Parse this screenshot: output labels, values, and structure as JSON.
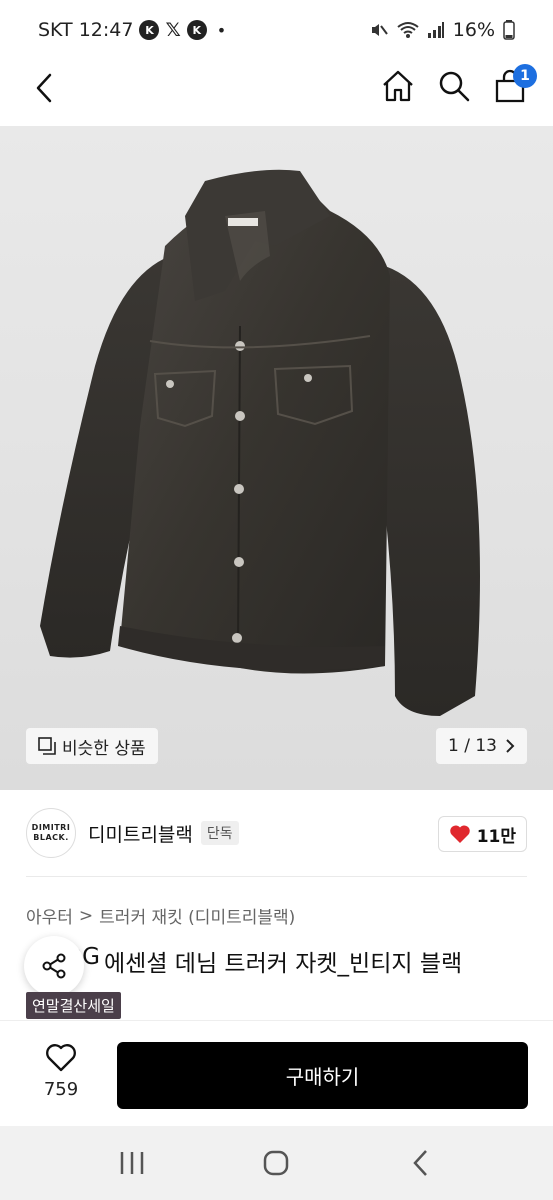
{
  "status_bar": {
    "carrier_time": "SKT 12:47",
    "battery": "16%",
    "icons": [
      "k-app-icon",
      "x-icon",
      "k-app-icon",
      "mute-icon",
      "wifi-icon",
      "signal-icon",
      "battery-icon"
    ]
  },
  "nav": {
    "cart_count": "1",
    "icons": [
      "back-icon",
      "home-icon",
      "search-icon",
      "cart-icon"
    ]
  },
  "image": {
    "similar_label": "비슷한 상품",
    "counter": "1 / 13"
  },
  "brand": {
    "logo_line1": "DIMITRI",
    "logo_line2": "BLACK.",
    "name": "디미트리블랙",
    "tag": "단독",
    "likes": "11만"
  },
  "product": {
    "breadcrumb_1": "아우터",
    "breadcrumb_sep": ">",
    "breadcrumb_2": "트러커 재킷 (디미트리블랙)",
    "title_prefix": "OG",
    "title": "에센셜 데님 트러커 자켓_빈티지 블랙",
    "sale_badge": "연말결산세일"
  },
  "bottom": {
    "wish_count": "759",
    "buy_label": "구매하기"
  },
  "colors": {
    "accent": "#1d6fe0",
    "buy_button": "#000000",
    "heart": "#e0282e",
    "sale_badge": "#4b3f4a"
  }
}
